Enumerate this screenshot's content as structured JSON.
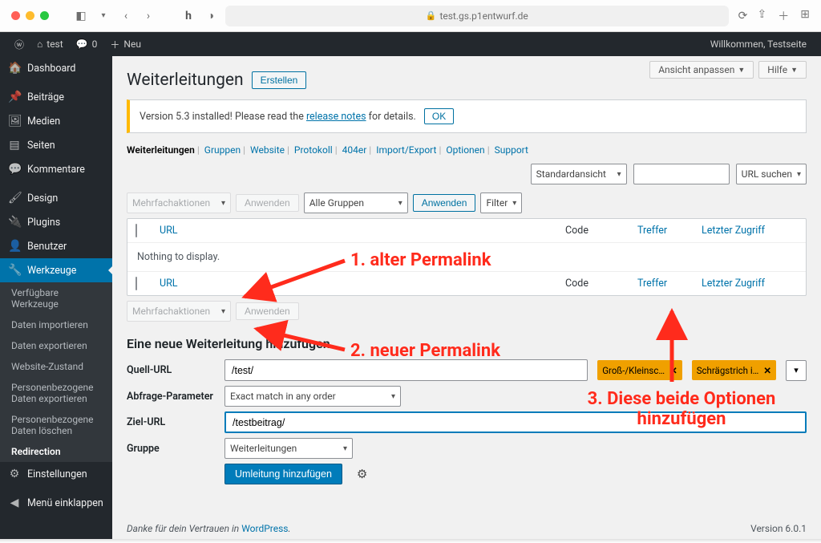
{
  "browser": {
    "url": "test.gs.p1entwurf.de"
  },
  "adminbar": {
    "site": "test",
    "comments": "0",
    "new": "Neu",
    "greeting": "Willkommen, Testseite"
  },
  "sidebar": {
    "items": [
      {
        "icon": "⌂",
        "label": "Dashboard"
      },
      {
        "icon": "✎",
        "label": "Beiträge"
      },
      {
        "icon": "🖼",
        "label": "Medien"
      },
      {
        "icon": "▤",
        "label": "Seiten"
      },
      {
        "icon": "💬",
        "label": "Kommentare"
      },
      {
        "icon": "🖌",
        "label": "Design"
      },
      {
        "icon": "🔌",
        "label": "Plugins"
      },
      {
        "icon": "👤",
        "label": "Benutzer"
      },
      {
        "icon": "🔧",
        "label": "Werkzeuge"
      }
    ],
    "sub_werkzeuge": [
      {
        "label": "Verfügbare Werkzeuge"
      },
      {
        "label": "Daten importieren"
      },
      {
        "label": "Daten exportieren"
      },
      {
        "label": "Website-Zustand"
      },
      {
        "label": "Personenbezogene Daten exportieren"
      },
      {
        "label": "Personenbezogene Daten löschen"
      },
      {
        "label": "Redirection"
      }
    ],
    "settings": {
      "icon": "☰",
      "label": "Einstellungen"
    },
    "collapse": {
      "icon": "◀",
      "label": "Menü einklappen"
    }
  },
  "screen": {
    "view": "Ansicht anpassen",
    "help": "Hilfe"
  },
  "page": {
    "title": "Weiterleitungen",
    "create": "Erstellen"
  },
  "notice": {
    "prefix": "Version 5.3 installed! Please read the ",
    "link": "release notes",
    "suffix": " for details.",
    "ok": "OK"
  },
  "subnav": [
    "Weiterleitungen",
    "Gruppen",
    "Website",
    "Protokoll",
    "404er",
    "Import/Export",
    "Optionen",
    "Support"
  ],
  "filters": {
    "standard": "Standardansicht",
    "search_btn": "URL suchen",
    "bulk": "Mehrfachaktionen",
    "apply": "Anwenden",
    "groups": "Alle Gruppen",
    "apply2": "Anwenden",
    "filter": "Filter"
  },
  "table": {
    "url": "URL",
    "code": "Code",
    "hits": "Treffer",
    "last": "Letzter Zugriff",
    "empty": "Nothing to display."
  },
  "section": "Eine neue Weiterleitung hinzufügen",
  "form": {
    "src_label": "Quell-URL",
    "src_value": "/test/",
    "tag1": "Groß-/Kleinsc…",
    "tag2": "Schrägstrich i…",
    "qp_label": "Abfrage-Parameter",
    "qp_value": "Exact match in any order",
    "target_label": "Ziel-URL",
    "target_value": "/testbeitrag/",
    "group_label": "Gruppe",
    "group_value": "Weiterleitungen",
    "submit": "Umleitung hinzufügen"
  },
  "footer": {
    "thanks_pre": "Danke für dein Vertrauen in ",
    "thanks_link": "WordPress",
    "version": "Version 6.0.1"
  },
  "annotations": {
    "a1": "1. alter Permalink",
    "a2": "2. neuer Permalink",
    "a3a": "3. Diese beide Optionen",
    "a3b": "hinzufügen"
  }
}
